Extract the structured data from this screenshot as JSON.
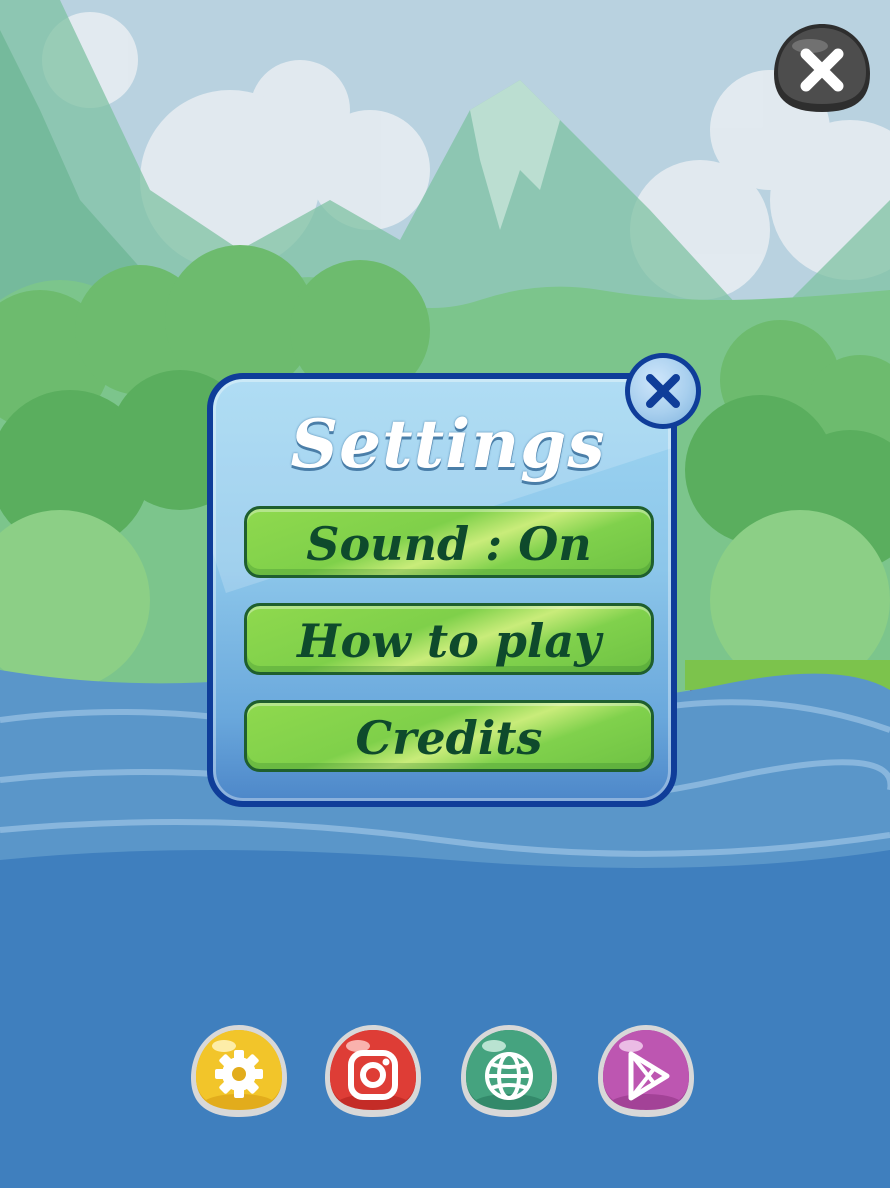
{
  "dialog": {
    "title": "Settings",
    "buttons": {
      "sound": "Sound : On",
      "how_to_play": "How to play",
      "credits": "Credits"
    }
  },
  "icons": {
    "top_close": "close-icon",
    "dialog_close": "close-icon",
    "settings": "gear-icon",
    "instagram": "instagram-icon",
    "website": "globe-icon",
    "store": "play-store-icon"
  },
  "colors": {
    "dialog_border": "#0f3d99",
    "button_green": "#7fd04a",
    "button_text": "#0e4a2c",
    "settings_yellow": "#e8b21f",
    "instagram_red": "#d93a34",
    "globe_green": "#3f9d78",
    "store_purple": "#b54fa8",
    "close_gray": "#4a4a4a"
  }
}
